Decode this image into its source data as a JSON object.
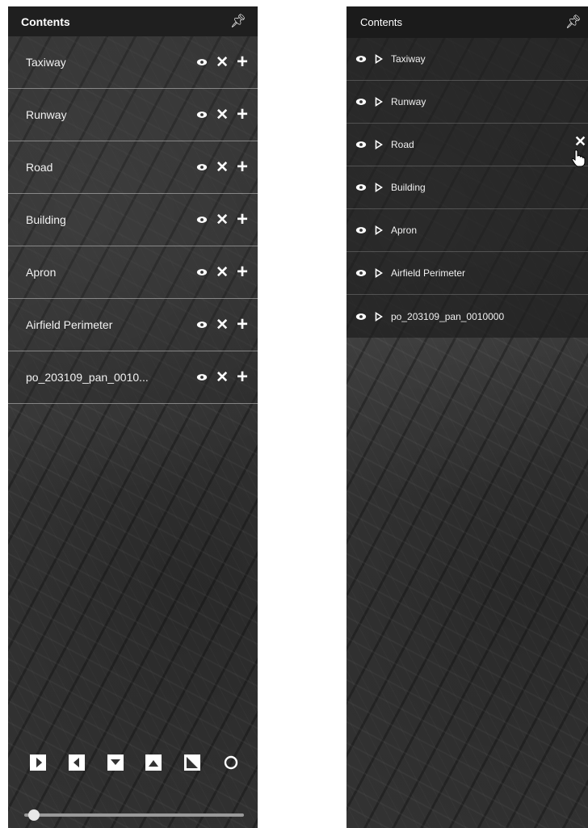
{
  "left_panel": {
    "title": "Contents",
    "pin_icon": "pin-icon",
    "layers": [
      {
        "label": "Taxiway"
      },
      {
        "label": "Runway"
      },
      {
        "label": "Road"
      },
      {
        "label": "Building"
      },
      {
        "label": "Apron"
      },
      {
        "label": "Airfield Perimeter"
      },
      {
        "label": "po_203109_pan_0010..."
      }
    ],
    "row_icons": [
      "eye-icon",
      "close-icon",
      "plus-icon"
    ],
    "tools": [
      "swipe-right-icon",
      "swipe-left-icon",
      "swipe-up-icon",
      "swipe-down-icon",
      "swipe-diagonal-icon",
      "reset-icon"
    ],
    "transparency_slider": {
      "value": 0.02
    }
  },
  "right_panel": {
    "title": "Contents",
    "pin_icon": "pin-icon",
    "layers": [
      {
        "label": "Taxiway"
      },
      {
        "label": "Runway"
      },
      {
        "label": "Road",
        "hover_close": true
      },
      {
        "label": "Building"
      },
      {
        "label": "Apron"
      },
      {
        "label": "Airfield Perimeter"
      },
      {
        "label": "po_203109_pan_0010000"
      }
    ],
    "row_icons": [
      "eye-icon",
      "expand-triangle-icon"
    ]
  },
  "colors": {
    "header": "#1f1f1f",
    "map": "#3a3a3a",
    "divider": "#c8c8c8"
  }
}
